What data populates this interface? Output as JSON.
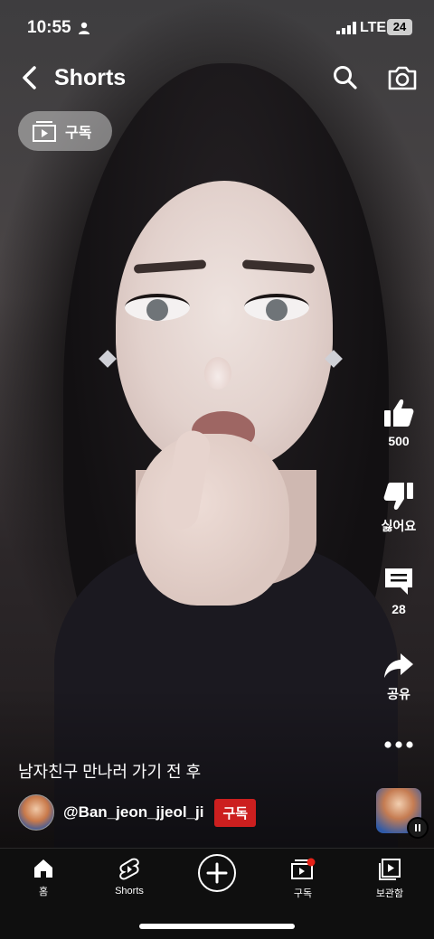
{
  "status_bar": {
    "time": "10:55",
    "network": "LTE",
    "battery": "24"
  },
  "header": {
    "title": "Shorts"
  },
  "subscriptions_chip": {
    "label": "구독"
  },
  "actions": {
    "like": {
      "count": "500"
    },
    "dislike": {
      "label": "싫어요"
    },
    "comments": {
      "count": "28"
    },
    "share": {
      "label": "공유"
    }
  },
  "video": {
    "caption": "남자친구 만나러 가기 전 후",
    "channel_handle": "@Ban_jeon_jjeol_ji",
    "subscribe_label": "구독"
  },
  "nav": {
    "home": "홈",
    "shorts": "Shorts",
    "subscriptions": "구독",
    "library": "보관함"
  },
  "colors": {
    "subscribe_red": "#cc1f1f",
    "nav_bg": "#0f0f0f",
    "notification_dot": "#e62117"
  }
}
